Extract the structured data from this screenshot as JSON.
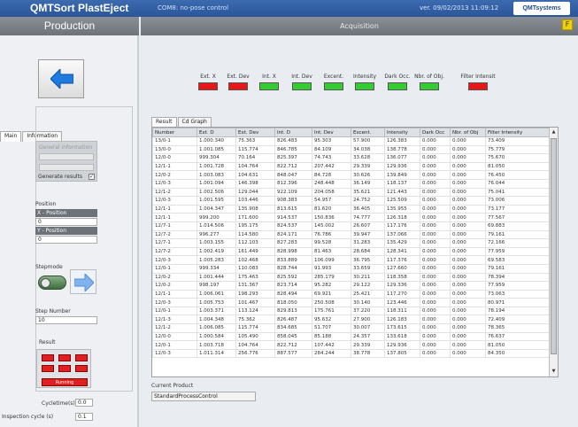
{
  "topbar": {
    "app_title": "QMTSort PlastEject",
    "subtitle": "COM8: no-pose control",
    "sysinfo": "ver. 09/02/2013 11:09:12",
    "logo": "QMTsystems"
  },
  "bar": {
    "left_title": "Production",
    "right_title": "Acquisition",
    "corner_icon": "F"
  },
  "left": {
    "tabs": [
      "Main",
      "Information"
    ],
    "group": {
      "label": "General information",
      "checkbox_label": "Generate results",
      "checked": "✓"
    },
    "position_label": "Position",
    "x_header": "X - Position",
    "x_value": "0",
    "y_header": "Y - Position",
    "y_value": "0",
    "stepmode_label": "Stepmode",
    "step_number_label": "Step Number",
    "step_number_value": "10",
    "result_label": "Result",
    "result_bar": "Running",
    "cycle_label": "Cycletime(s)",
    "cycle_value": "0.0",
    "inspection_label": "Inspection cycle (s)",
    "inspection_value": "0.1"
  },
  "indicators": [
    {
      "label": "Ext. X",
      "state": "red"
    },
    {
      "label": "Ext. Dev",
      "state": "red"
    },
    {
      "label": "Int. X",
      "state": "green"
    },
    {
      "label": "Int. Dev",
      "state": "green"
    },
    {
      "label": "Excent.",
      "state": "green"
    },
    {
      "label": "Intensity",
      "state": "green"
    },
    {
      "label": "Dark Occ.",
      "state": "green"
    },
    {
      "label": "Nbr. of Obj.",
      "state": "green"
    },
    {
      "label": "Filter Intensit",
      "state": "red"
    }
  ],
  "right_tabs": [
    "Result",
    "Cd Graph"
  ],
  "table": {
    "columns": [
      "Number",
      "Ext. D",
      "Ext. Dev",
      "Int. D",
      "Int. Dev",
      "Excent.",
      "Intensity",
      "Dark Occ",
      "Nbr. of Obj",
      "Filter Intensity"
    ],
    "rows": [
      [
        "13/0-1",
        "1.000.340",
        "75.363",
        "826.483",
        "95.303",
        "57.900",
        "126.383",
        "0.000",
        "0.000",
        "73.409"
      ],
      [
        "13/0-0",
        "1.001.085",
        "115.774",
        "846.785",
        "84.109",
        "34.038",
        "138.778",
        "0.000",
        "0.000",
        "75.779"
      ],
      [
        "12/0-0",
        "999.304",
        "70.164",
        "825.397",
        "74.743",
        "33.628",
        "136.077",
        "0.000",
        "0.000",
        "75.670"
      ],
      [
        "12/1-1",
        "1.001.728",
        "104.764",
        "822.712",
        "207.442",
        "29.339",
        "129.936",
        "0.000",
        "0.000",
        "81.050"
      ],
      [
        "12/0-2",
        "1.003.083",
        "104.631",
        "848.047",
        "84.728",
        "30.626",
        "139.849",
        "0.000",
        "0.000",
        "76.450"
      ],
      [
        "12/0-3",
        "1.001.094",
        "146.398",
        "812.396",
        "248.448",
        "36.149",
        "118.137",
        "0.000",
        "0.000",
        "76.044"
      ],
      [
        "12/1-2",
        "1.002.506",
        "129.044",
        "922.109",
        "204.058",
        "35.621",
        "121.443",
        "0.000",
        "0.000",
        "75.041"
      ],
      [
        "12/0-3",
        "1.001.595",
        "103.446",
        "908.383",
        "54.957",
        "24.752",
        "125.509",
        "0.000",
        "0.000",
        "73.006"
      ],
      [
        "12/1-1",
        "1.004.347",
        "135.908",
        "813.615",
        "81.620",
        "36.405",
        "135.955",
        "0.000",
        "0.000",
        "73.177"
      ],
      [
        "12/1-1",
        "999.200",
        "171.600",
        "914.537",
        "150.836",
        "74.777",
        "126.318",
        "0.000",
        "0.000",
        "77.567"
      ],
      [
        "12/7-1",
        "1.014.506",
        "195.175",
        "824.537",
        "145.002",
        "26.607",
        "117.176",
        "0.000",
        "0.000",
        "69.883"
      ],
      [
        "12/7-2",
        "996.277",
        "114.580",
        "824.171",
        "76.786",
        "39.947",
        "137.066",
        "0.000",
        "0.000",
        "79.161"
      ],
      [
        "12/7-1",
        "1.003.155",
        "112.103",
        "827.283",
        "99.528",
        "31.283",
        "135.429",
        "0.000",
        "0.000",
        "72.166"
      ],
      [
        "12/7-2",
        "1.002.419",
        "161.449",
        "828.998",
        "81.463",
        "28.684",
        "128.341",
        "0.000",
        "0.000",
        "77.959"
      ],
      [
        "12/0-3",
        "1.005.283",
        "102.468",
        "833.889",
        "106.099",
        "36.795",
        "117.376",
        "0.000",
        "0.000",
        "69.583"
      ],
      [
        "12/0-1",
        "999.334",
        "110.083",
        "828.744",
        "91.993",
        "33.659",
        "127.660",
        "0.000",
        "0.000",
        "79.161"
      ],
      [
        "12/0-2",
        "1.001.444",
        "175.463",
        "825.592",
        "285.179",
        "30.211",
        "118.358",
        "0.000",
        "0.000",
        "78.394"
      ],
      [
        "12/0-2",
        "998.197",
        "131.367",
        "823.714",
        "95.282",
        "29.122",
        "129.336",
        "0.000",
        "0.000",
        "77.959"
      ],
      [
        "12/1-1",
        "1.006.061",
        "198.293",
        "828.494",
        "69.921",
        "25.421",
        "117.270",
        "0.000",
        "0.000",
        "73.063"
      ],
      [
        "12/0-3",
        "1.005.753",
        "101.467",
        "818.050",
        "250.508",
        "30.140",
        "123.446",
        "0.000",
        "0.000",
        "80.971"
      ],
      [
        "12/0-1",
        "1.003.371",
        "113.124",
        "829.813",
        "175.761",
        "37.220",
        "118.311",
        "0.000",
        "0.000",
        "78.194"
      ],
      [
        "12/1-3",
        "1.004.348",
        "75.362",
        "826.487",
        "95.632",
        "27.900",
        "126.183",
        "0.000",
        "0.000",
        "72.409"
      ],
      [
        "12/1-2",
        "1.006.085",
        "115.774",
        "834.685",
        "51.707",
        "30.007",
        "173.615",
        "0.000",
        "0.000",
        "78.365"
      ],
      [
        "12/0-0",
        "1.000.584",
        "105.490",
        "858.045",
        "85.188",
        "24.357",
        "133.618",
        "0.000",
        "0.000",
        "76.637"
      ],
      [
        "12/0-1",
        "1.003.718",
        "104.764",
        "822.712",
        "107.442",
        "29.339",
        "129.936",
        "0.000",
        "0.000",
        "81.050"
      ],
      [
        "12/0-3",
        "1.011.314",
        "256.776",
        "887.577",
        "284.244",
        "38.778",
        "137.805",
        "0.000",
        "0.000",
        "84.350"
      ]
    ]
  },
  "current_product": {
    "label": "Current Product",
    "value": "StandardProcessControl"
  },
  "colors": {
    "topbar": "#2e5aa0",
    "bar": "#7a7f86",
    "alarm": "#e81818",
    "ok": "#33cc33"
  }
}
